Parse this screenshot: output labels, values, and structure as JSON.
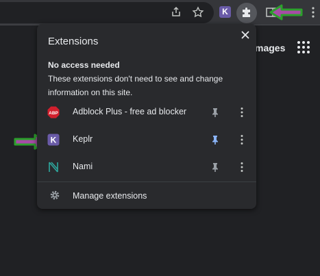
{
  "toolbar": {
    "icons": [
      "share-icon",
      "bookmark-star-icon",
      "keplr-extension-icon",
      "extensions-puzzle-icon",
      "sidebar-icon",
      "menu-more-icon"
    ],
    "keplr_letter": "K"
  },
  "page": {
    "images_link": "mages",
    "apps_icon": "apps-grid-icon"
  },
  "popup": {
    "title": "Extensions",
    "section_title": "No access needed",
    "section_desc": "These extensions don't need to see and change information on this site.",
    "extensions": [
      {
        "name": "Adblock Plus - free ad blocker",
        "logo": "abp-icon",
        "logo_text": "ABP",
        "pinned": false
      },
      {
        "name": "Keplr",
        "logo": "keplr-icon",
        "logo_text": "K",
        "pinned": true
      },
      {
        "name": "Nami",
        "logo": "nami-icon",
        "logo_text": "N",
        "pinned": false
      }
    ],
    "manage_label": "Manage extensions"
  },
  "colors": {
    "pin_active": "#8ab4f8",
    "pin_inactive": "#9aa0a6",
    "arrow_fill": "#a64ca6",
    "arrow_stroke": "#2ca02c",
    "abp_red": "#d21f2d",
    "keplr_purple": "#6a5ba8",
    "nami_teal": "#2ea89e"
  }
}
